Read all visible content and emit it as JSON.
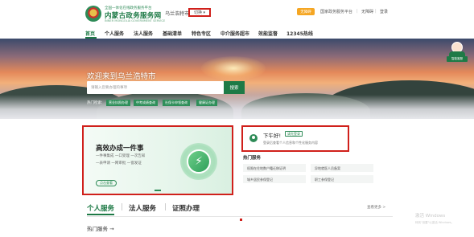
{
  "header": {
    "logo_sub": "全国一体化在线政务服务平台",
    "logo_title": "内蒙古政务服务网",
    "logo_en": "INNER MONGOLIA GOVERNMENT SERVICE",
    "city": "乌兰浩特市",
    "switch_label": "切换 ▾",
    "badge": "无障碍",
    "links": [
      "国家政务服务平台",
      "无障碍",
      "登录"
    ]
  },
  "nav": {
    "items": [
      "首页",
      "个人服务",
      "法人服务",
      "基础清单",
      "特色专区",
      "中介服务超市",
      "效能监督",
      "12345热线"
    ]
  },
  "hero": {
    "title": "欢迎来到乌兰浩特市",
    "search_placeholder": "请输入您要办理的事项",
    "search_button": "搜索",
    "hot_label": "热门检索:",
    "hot_tags": [
      "营业执照办理",
      "中考成绩查询",
      "社保卡申领查询",
      "健康证办理"
    ]
  },
  "assistant": {
    "label": "智能客服"
  },
  "card": {
    "title": "高效办成一件事",
    "lines": [
      "一件事集成 一口受理 一次告知",
      "一表申请 一网审批 一窗发证"
    ],
    "button": "点击查看",
    "accent": "#2e8b57"
  },
  "greeting": {
    "hi": "下午好!",
    "login": "请先登录",
    "desc": "登录后查看个人信息和个性化服务内容"
  },
  "hot_services": {
    "title": "热门服务",
    "items": [
      "权限在住地数户籍迁移证明",
      "异地就医人员备案",
      "城乡居民参保登记",
      "职工参保登记"
    ]
  },
  "tabs": {
    "items": [
      "个人服务",
      "法人服务",
      "证照办理"
    ],
    "more": "查看更多 >"
  },
  "section": {
    "hot_title": "热门服务 →"
  },
  "watermark": {
    "line1": "激活 Windows",
    "line2": "转到\"设置\"以激活 Windows。"
  },
  "colors": {
    "brand": "#1e7a46",
    "highlight": "#d0201b",
    "badge": "#f5a623"
  }
}
